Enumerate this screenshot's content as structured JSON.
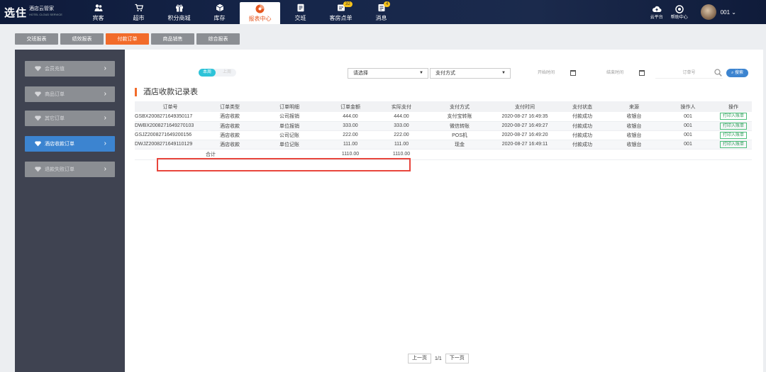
{
  "brand": {
    "logo": "选住",
    "name": "酒店云管家",
    "sub": "HOTEL CLOUD SERVICE"
  },
  "nav": [
    {
      "label": "宾客",
      "icon": "guest-icon"
    },
    {
      "label": "超市",
      "icon": "cart-icon"
    },
    {
      "label": "积分商城",
      "icon": "gift-icon"
    },
    {
      "label": "库存",
      "icon": "box-icon"
    },
    {
      "label": "报表中心",
      "icon": "pie-chart-icon",
      "active": true
    },
    {
      "label": "交班",
      "icon": "shift-icon"
    },
    {
      "label": "客房点单",
      "icon": "room-order-icon",
      "badge": "32"
    },
    {
      "label": "消息",
      "icon": "message-icon",
      "badge": "4"
    }
  ],
  "tools": [
    {
      "label": "云平台",
      "icon": "cloud-icon"
    },
    {
      "label": "帮助中心",
      "icon": "help-icon"
    }
  ],
  "user": {
    "name": "001"
  },
  "tabs": [
    "交班报表",
    "绩效报表",
    "付款订单",
    "商品销售",
    "综合报表"
  ],
  "sidebar": [
    {
      "label": "会员充值"
    },
    {
      "label": "商品订单"
    },
    {
      "label": "其它订单"
    },
    {
      "label": "酒店收款订单",
      "active": true
    },
    {
      "label": "退款失败订单"
    }
  ],
  "filters": {
    "toggle_on": "本周",
    "toggle_off": "上周",
    "select1": "请选择",
    "select2": "支付方式",
    "start_date": "开始时间",
    "end_date": "结束时间",
    "order_no": "订单号",
    "search": "搜索"
  },
  "section_title": "酒店收款记录表",
  "table": {
    "headers": [
      "订单号",
      "订单类型",
      "订单明细",
      "订单金额",
      "实际支付",
      "支付方式",
      "支付时间",
      "支付状态",
      "来源",
      "操作人",
      "操作"
    ],
    "rows": [
      [
        "GSBX2008271649350117",
        "酒店收款",
        "公司报销",
        "444.00",
        "444.00",
        "支付宝转账",
        "2020-08-27 16:49:35",
        "付款成功",
        "收银台",
        "001",
        "打印入账单"
      ],
      [
        "DWBX2008271649270103",
        "酒店收款",
        "单位报销",
        "333.00",
        "333.00",
        "微信转账",
        "2020-08-27 16:49:27",
        "付款成功",
        "收银台",
        "001",
        "打印入账单"
      ],
      [
        "GSJZ2008271649200156",
        "酒店收款",
        "公司记账",
        "222.00",
        "222.00",
        "POS机",
        "2020-08-27 16:49:20",
        "付款成功",
        "收银台",
        "001",
        "打印入账单"
      ],
      [
        "DWJZ2008271649110129",
        "酒店收款",
        "单位记账",
        "111.00",
        "111.00",
        "现金",
        "2020-08-27 16:49:11",
        "付款成功",
        "收银台",
        "001",
        "打印入账单"
      ]
    ],
    "total": {
      "label": "合计",
      "amount": "1110.00",
      "paid": "1110.00"
    }
  },
  "pager": {
    "prev": "上一页",
    "info": "1/1",
    "next": "下一页"
  },
  "colors": {
    "accent": "#f26b2a",
    "primary": "#3c84d0",
    "highlight": "#e8453c"
  }
}
